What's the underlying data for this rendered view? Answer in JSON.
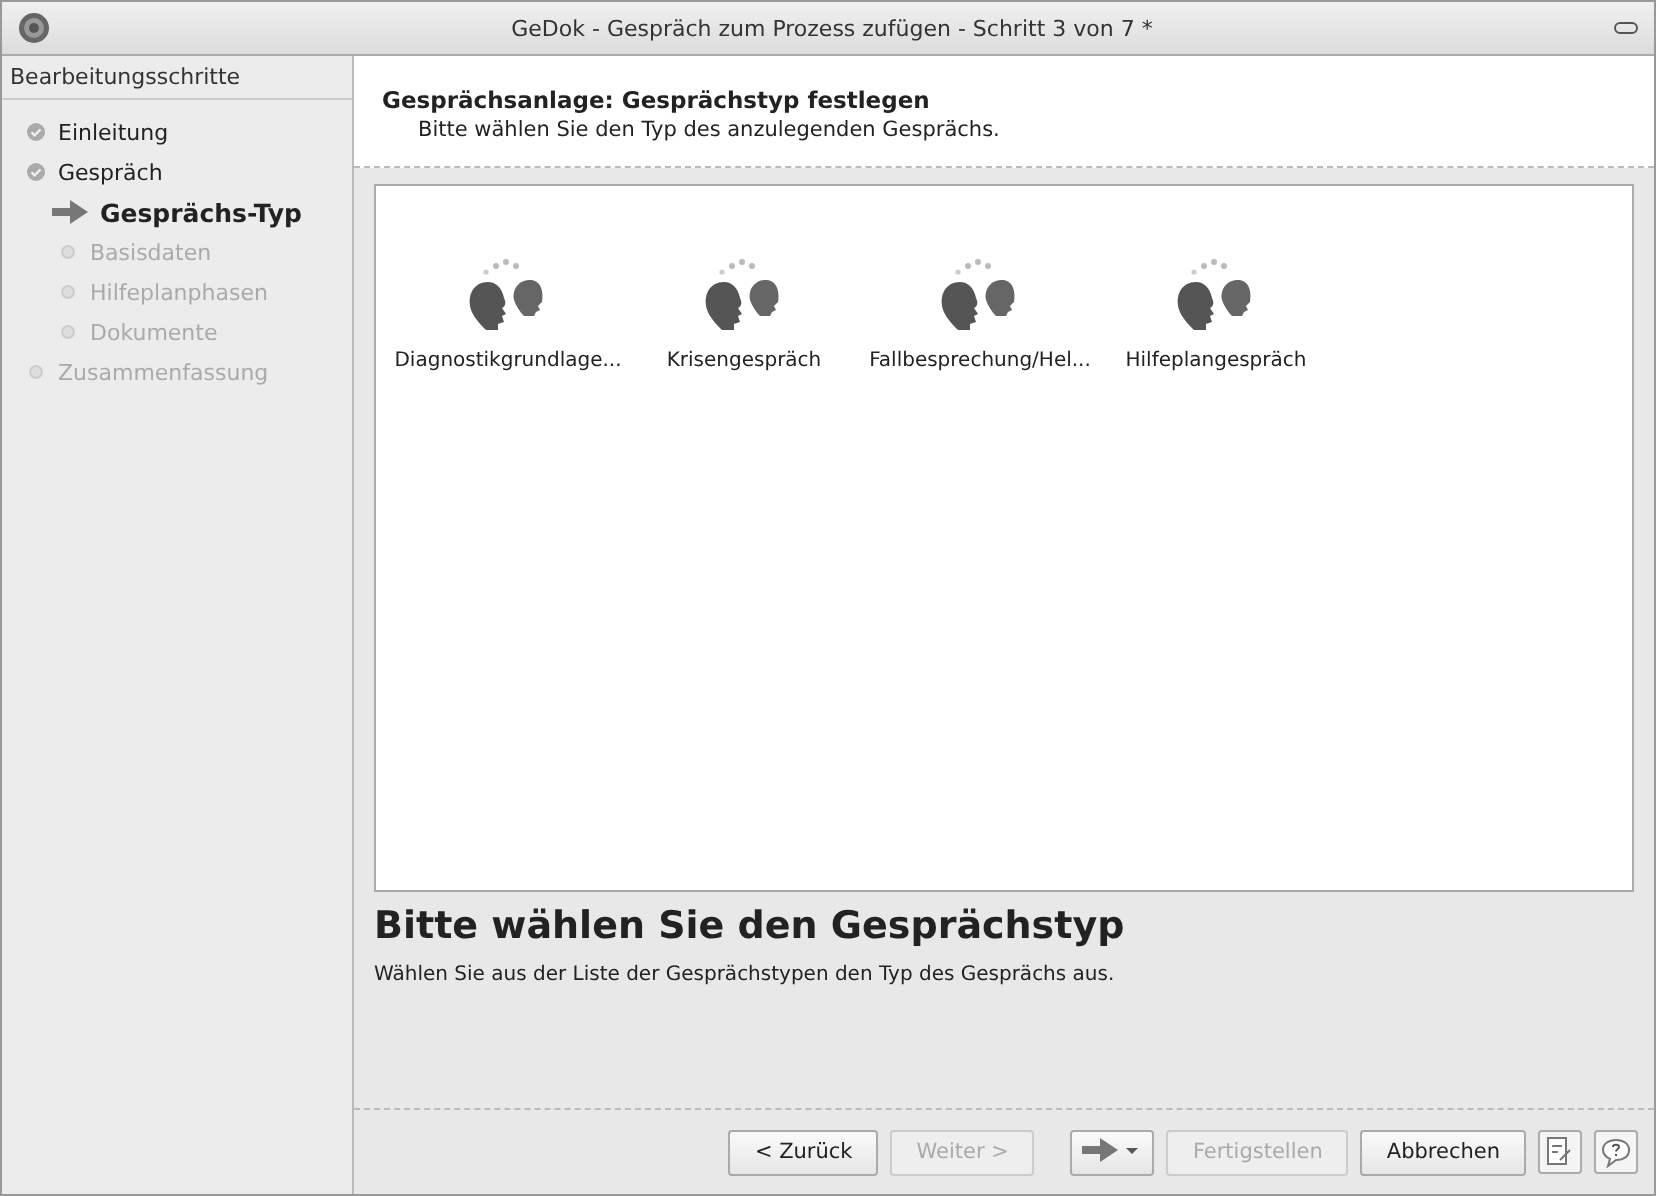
{
  "window": {
    "title": "GeDok - Gespräch zum Prozess zufügen - Schritt 3 von 7 *"
  },
  "sidebar": {
    "title": "Bearbeitungsschritte",
    "steps": [
      {
        "label": "Einleitung",
        "done": true
      },
      {
        "label": "Gespräch",
        "done": true,
        "children": [
          {
            "label": "Gesprächs-Typ",
            "done": false,
            "current": true
          },
          {
            "label": "Basisdaten",
            "done": false,
            "current": false
          },
          {
            "label": "Hilfeplanphasen",
            "done": false,
            "current": false
          },
          {
            "label": "Dokumente",
            "done": false,
            "current": false
          }
        ]
      },
      {
        "label": "Zusammenfassung",
        "done": false
      }
    ]
  },
  "header": {
    "title": "Gesprächsanlage: Gesprächstyp festlegen",
    "subtitle": "Bitte wählen Sie den Typ des anzulegenden Gesprächs."
  },
  "types": [
    {
      "label": "Diagnostikgrundlage..."
    },
    {
      "label": "Krisengespräch"
    },
    {
      "label": "Fallbesprechung/Hel..."
    },
    {
      "label": "Hilfeplangespräch"
    }
  ],
  "info": {
    "heading": "Bitte wählen Sie den Gesprächstyp",
    "text": "Wählen Sie aus der Liste der Gesprächstypen den Typ des Gesprächs aus."
  },
  "buttons": [
    {
      "kind": "text",
      "label": "< Zurück",
      "disabled": false
    },
    {
      "kind": "text",
      "label": "Weiter >",
      "disabled": true
    },
    {
      "kind": "menu",
      "disabled": false
    },
    {
      "kind": "text",
      "label": "Fertigstellen",
      "disabled": true
    },
    {
      "kind": "text",
      "label": "Abbrechen",
      "disabled": false
    }
  ]
}
